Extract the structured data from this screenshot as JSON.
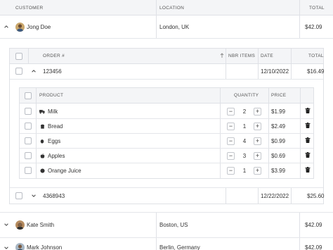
{
  "customers_grid": {
    "headers": {
      "customer": "CUSTOMER",
      "location": "LOCATION",
      "total": "TOTAL"
    },
    "rows": [
      {
        "name": "Jong Doe",
        "location": "London, UK",
        "total": "$42.09",
        "expanded": true
      },
      {
        "name": "Kate Smith",
        "location": "Boston, US",
        "total": "$42.09",
        "expanded": false
      },
      {
        "name": "Mark Johnson",
        "location": "Berlin, Germany",
        "total": "$42.09",
        "expanded": false
      }
    ]
  },
  "orders_grid": {
    "headers": {
      "order": "ORDER #",
      "nbr_items": "NBR ITEMS",
      "date": "DATE",
      "total": "TOTAL"
    },
    "rows": [
      {
        "order": "123456",
        "date": "12/10/2022",
        "total": "$16.49",
        "expanded": true
      },
      {
        "order": "4368943",
        "date": "12/22/2022",
        "total": "$25.60",
        "expanded": false
      }
    ]
  },
  "products_grid": {
    "headers": {
      "product": "PRODUCT",
      "quantity": "QUANTITY",
      "price": "PRICE"
    },
    "rows": [
      {
        "product": "Milk",
        "icon": "truck-icon",
        "quantity": "2",
        "price": "$1.99"
      },
      {
        "product": "Bread",
        "icon": "bread-icon",
        "quantity": "1",
        "price": "$2.49"
      },
      {
        "product": "Eggs",
        "icon": "egg-icon",
        "quantity": "4",
        "price": "$0.99"
      },
      {
        "product": "Apples",
        "icon": "apple-icon",
        "quantity": "3",
        "price": "$0.69"
      },
      {
        "product": "Orange Juice",
        "icon": "orange-icon",
        "quantity": "1",
        "price": "$3.99"
      }
    ],
    "minus": "−",
    "plus": "+"
  }
}
